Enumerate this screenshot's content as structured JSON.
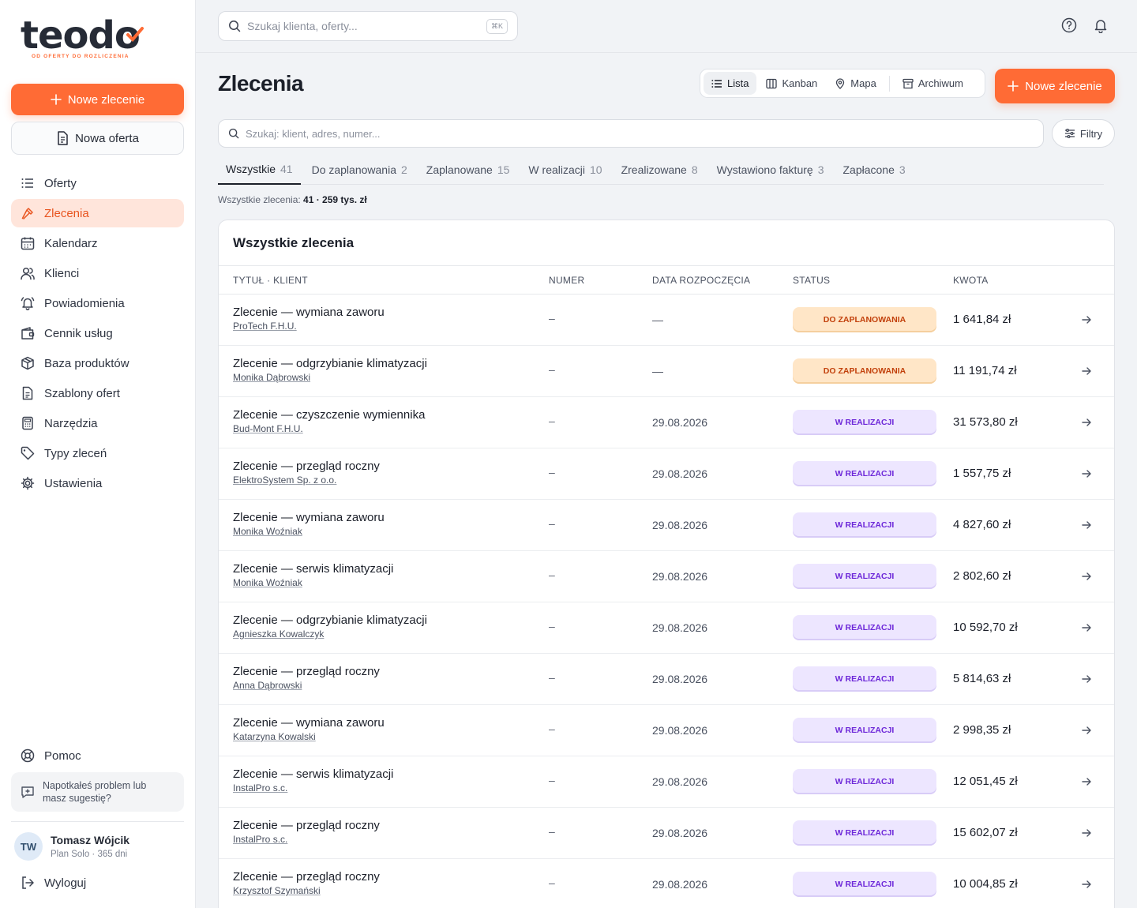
{
  "brand": {
    "name": "teodo",
    "tagline": "OD OFERTY DO ROZLICZENIA",
    "accent": "#ff6b35"
  },
  "sidebar": {
    "new_order": "Nowe zlecenie",
    "new_offer": "Nowa oferta",
    "items": [
      {
        "label": "Oferty",
        "icon": "list-icon"
      },
      {
        "label": "Zlecenia",
        "icon": "hammer-icon",
        "active": true
      },
      {
        "label": "Kalendarz",
        "icon": "calendar-icon"
      },
      {
        "label": "Klienci",
        "icon": "users-icon"
      },
      {
        "label": "Powiadomienia",
        "icon": "bell-icon"
      },
      {
        "label": "Cennik usług",
        "icon": "wallet-icon"
      },
      {
        "label": "Baza produktów",
        "icon": "box-icon"
      },
      {
        "label": "Szablony ofert",
        "icon": "document-icon"
      },
      {
        "label": "Narzędzia",
        "icon": "calculator-icon"
      },
      {
        "label": "Typy zleceń",
        "icon": "tag-icon"
      },
      {
        "label": "Ustawienia",
        "icon": "gear-icon"
      }
    ],
    "help": "Pomoc",
    "feedback": "Napotkałeś problem lub masz sugestię?",
    "user": {
      "initials": "TW",
      "name": "Tomasz Wójcik",
      "plan": "Plan Solo · 365 dni"
    },
    "logout": "Wyloguj"
  },
  "topbar": {
    "search_placeholder": "Szukaj klienta, oferty...",
    "shortcut": "⌘K"
  },
  "page": {
    "title": "Zlecenia",
    "views": [
      "Lista",
      "Kanban",
      "Mapa",
      "Archiwum"
    ],
    "active_view": "Lista",
    "new_button": "Nowe zlecenie",
    "search_placeholder": "Szukaj: klient, adres, numer...",
    "filters_label": "Filtry",
    "tabs": [
      {
        "label": "Wszystkie",
        "count": "41"
      },
      {
        "label": "Do zaplanowania",
        "count": "2"
      },
      {
        "label": "Zaplanowane",
        "count": "15"
      },
      {
        "label": "W realizacji",
        "count": "10"
      },
      {
        "label": "Zrealizowane",
        "count": "8"
      },
      {
        "label": "Wystawiono fakturę",
        "count": "3"
      },
      {
        "label": "Zapłacone",
        "count": "3"
      }
    ],
    "summary_label": "Wszystkie zlecenia:",
    "summary_value": "41 · 259 tys. zł"
  },
  "table": {
    "title": "Wszystkie zlecenia",
    "columns": [
      "TYTUŁ · KLIENT",
      "NUMER",
      "DATA ROZPOCZĘCIA",
      "STATUS",
      "KWOTA"
    ],
    "rows": [
      {
        "title": "Zlecenie — wymiana zaworu",
        "client": "ProTech F.H.U.",
        "number": "–",
        "date": "—",
        "status": "DO ZAPLANOWANIA",
        "status_type": "plan",
        "amount": "1 641,84 zł"
      },
      {
        "title": "Zlecenie — odgrzybianie klimatyzacji",
        "client": "Monika Dąbrowski",
        "number": "–",
        "date": "—",
        "status": "DO ZAPLANOWANIA",
        "status_type": "plan",
        "amount": "11 191,74 zł"
      },
      {
        "title": "Zlecenie — czyszczenie wymiennika",
        "client": "Bud-Mont F.H.U.",
        "number": "–",
        "date": "29.08.2026",
        "status": "W REALIZACJI",
        "status_type": "real",
        "amount": "31 573,80 zł"
      },
      {
        "title": "Zlecenie — przegląd roczny",
        "client": "ElektroSystem Sp. z o.o.",
        "number": "–",
        "date": "29.08.2026",
        "status": "W REALIZACJI",
        "status_type": "real",
        "amount": "1 557,75 zł"
      },
      {
        "title": "Zlecenie — wymiana zaworu",
        "client": "Monika Woźniak",
        "number": "–",
        "date": "29.08.2026",
        "status": "W REALIZACJI",
        "status_type": "real",
        "amount": "4 827,60 zł"
      },
      {
        "title": "Zlecenie — serwis klimatyzacji",
        "client": "Monika Woźniak",
        "number": "–",
        "date": "29.08.2026",
        "status": "W REALIZACJI",
        "status_type": "real",
        "amount": "2 802,60 zł"
      },
      {
        "title": "Zlecenie — odgrzybianie klimatyzacji",
        "client": "Agnieszka Kowalczyk",
        "number": "–",
        "date": "29.08.2026",
        "status": "W REALIZACJI",
        "status_type": "real",
        "amount": "10 592,70 zł"
      },
      {
        "title": "Zlecenie — przegląd roczny",
        "client": "Anna Dąbrowski",
        "number": "–",
        "date": "29.08.2026",
        "status": "W REALIZACJI",
        "status_type": "real",
        "amount": "5 814,63 zł"
      },
      {
        "title": "Zlecenie — wymiana zaworu",
        "client": "Katarzyna Kowalski",
        "number": "–",
        "date": "29.08.2026",
        "status": "W REALIZACJI",
        "status_type": "real",
        "amount": "2 998,35 zł"
      },
      {
        "title": "Zlecenie — serwis klimatyzacji",
        "client": "InstalPro s.c.",
        "number": "–",
        "date": "29.08.2026",
        "status": "W REALIZACJI",
        "status_type": "real",
        "amount": "12 051,45 zł"
      },
      {
        "title": "Zlecenie — przegląd roczny",
        "client": "InstalPro s.c.",
        "number": "–",
        "date": "29.08.2026",
        "status": "W REALIZACJI",
        "status_type": "real",
        "amount": "15 602,07 zł"
      },
      {
        "title": "Zlecenie — przegląd roczny",
        "client": "Krzysztof Szymański",
        "number": "–",
        "date": "29.08.2026",
        "status": "W REALIZACJI",
        "status_type": "real",
        "amount": "10 004,85 zł"
      }
    ]
  }
}
